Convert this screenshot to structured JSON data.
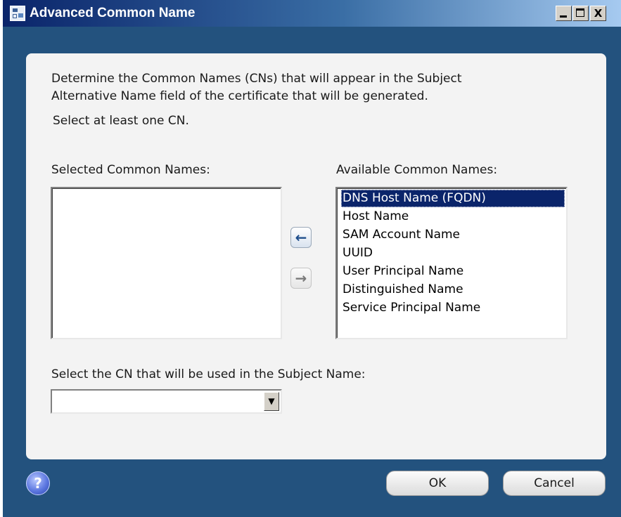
{
  "window": {
    "title": "Advanced Common Name",
    "icon": "certificate-app-icon",
    "controls": {
      "minimize_icon": "minimize-icon",
      "maximize_icon": "maximize-icon",
      "close_glyph": "X"
    }
  },
  "instructions": {
    "line1": "Determine the Common Names (CNs) that will appear in the Subject",
    "line2": "Alternative Name field of the certificate that will be generated.",
    "line3": "Select at least one CN."
  },
  "selected_list": {
    "label": "Selected Common Names:",
    "items": []
  },
  "available_list": {
    "label": "Available Common Names:",
    "selected_index": 0,
    "items": [
      "DNS Host Name (FQDN)",
      "Host Name",
      "SAM Account Name",
      "UUID",
      "User Principal Name",
      "Distinguished Name",
      "Service Principal Name"
    ]
  },
  "move_buttons": {
    "add_glyph": "←",
    "remove_glyph": "→",
    "remove_enabled": false
  },
  "subject_select": {
    "label": "Select the CN that will be used in the Subject Name:",
    "value": "",
    "dropdown_glyph": "▼"
  },
  "footer": {
    "help_glyph": "?",
    "ok_label": "OK",
    "cancel_label": "Cancel"
  },
  "colors": {
    "window_frame": "#23527e",
    "panel": "#f3f3f3",
    "selection": "#0a246a"
  }
}
